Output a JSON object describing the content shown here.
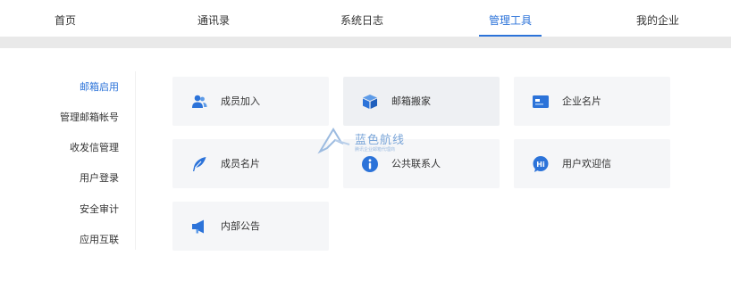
{
  "topnav": {
    "tabs": [
      {
        "label": "首页",
        "active": false
      },
      {
        "label": "通讯录",
        "active": false
      },
      {
        "label": "系统日志",
        "active": false
      },
      {
        "label": "管理工具",
        "active": true
      },
      {
        "label": "我的企业",
        "active": false
      }
    ]
  },
  "sidebar": {
    "items": [
      {
        "label": "邮箱启用",
        "active": true
      },
      {
        "label": "管理邮箱帐号",
        "active": false
      },
      {
        "label": "收发信管理",
        "active": false
      },
      {
        "label": "用户登录",
        "active": false
      },
      {
        "label": "安全审计",
        "active": false
      },
      {
        "label": "应用互联",
        "active": false
      }
    ]
  },
  "tools": [
    {
      "label": "成员加入",
      "icon": "users-icon"
    },
    {
      "label": "邮箱搬家",
      "icon": "box-icon"
    },
    {
      "label": "企业名片",
      "icon": "card-icon"
    },
    {
      "label": "成员名片",
      "icon": "feather-icon"
    },
    {
      "label": "公共联系人",
      "icon": "info-icon"
    },
    {
      "label": "用户欢迎信",
      "icon": "hi-bubble-icon"
    },
    {
      "label": "内部公告",
      "icon": "megaphone-icon"
    }
  ],
  "watermark": {
    "title": "蓝色航线",
    "subtitle": "腾讯企业邮箱代理商"
  },
  "colors": {
    "accent": "#2c73d9",
    "card_bg": "#f5f6f8",
    "divider": "#e9e9e9"
  }
}
